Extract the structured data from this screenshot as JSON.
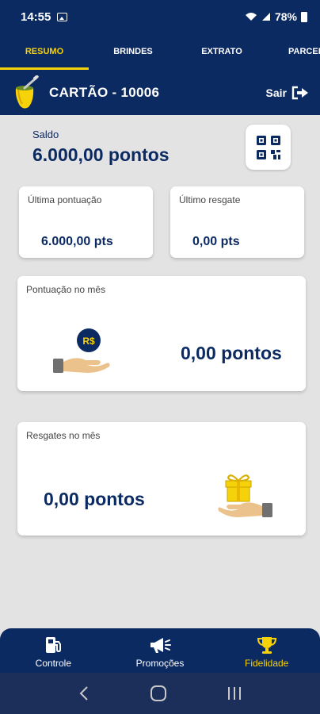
{
  "status_bar": {
    "time": "14:55",
    "battery": "78%"
  },
  "tabs": [
    {
      "label": "RESUMO",
      "active": true
    },
    {
      "label": "BRINDES",
      "active": false
    },
    {
      "label": "EXTRATO",
      "active": false
    },
    {
      "label": "PARCEIROS",
      "active": false
    }
  ],
  "header": {
    "card_title": "CARTÃO - 10006",
    "logout_label": "Sair"
  },
  "balance": {
    "label": "Saldo",
    "value": "6.000,00 pontos"
  },
  "last_score": {
    "label": "Última pontuação",
    "value": "6.000,00 pts"
  },
  "last_redeem": {
    "label": "Último resgate",
    "value": "0,00 pts"
  },
  "month_score": {
    "label": "Pontuação no mês",
    "value": "0,00 pontos",
    "icon_text": "R$"
  },
  "month_redeem": {
    "label": "Resgates no mês",
    "value": "0,00 pontos"
  },
  "bottom_nav": [
    {
      "label": "Controle",
      "icon": "fuel-pump-icon",
      "active": false
    },
    {
      "label": "Promoções",
      "icon": "megaphone-icon",
      "active": false
    },
    {
      "label": "Fidelidade",
      "icon": "trophy-icon",
      "active": true
    }
  ],
  "colors": {
    "primary": "#0c2a62",
    "accent": "#f6d20a",
    "background": "#e3e3e3"
  }
}
